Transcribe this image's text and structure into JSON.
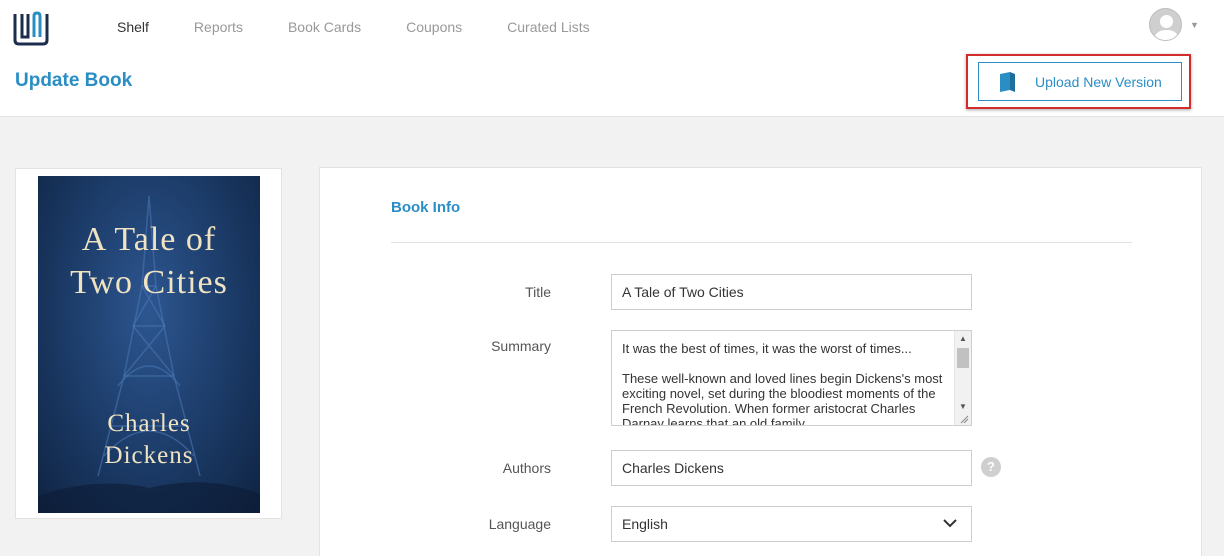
{
  "nav": {
    "items": [
      {
        "label": "Shelf",
        "active": true
      },
      {
        "label": "Reports",
        "active": false
      },
      {
        "label": "Book Cards",
        "active": false
      },
      {
        "label": "Coupons",
        "active": false
      },
      {
        "label": "Curated Lists",
        "active": false
      }
    ]
  },
  "header": {
    "page_title": "Update Book",
    "upload_button_label": "Upload New Version"
  },
  "cover": {
    "title_line1": "A Tale of",
    "title_line2": "Two Cities",
    "author_line1": "Charles",
    "author_line2": "Dickens"
  },
  "form": {
    "section_title": "Book Info",
    "title_label": "Title",
    "title_value": "A Tale of Two Cities",
    "summary_label": "Summary",
    "summary_value": "It was the best of times, it was the worst of times...\n\nThese well-known and loved lines begin Dickens's most exciting novel, set during the bloodiest moments of the French Revolution. When former aristocrat Charles Darnay learns that an old family",
    "authors_label": "Authors",
    "authors_value": "Charles Dickens",
    "help_glyph": "?",
    "language_label": "Language",
    "language_value": "English"
  },
  "colors": {
    "accent": "#2a8ec5",
    "highlight": "#d22b2b",
    "inactive_nav": "#999999"
  },
  "icons": {
    "logo": "brand-logo-icon",
    "avatar": "user-avatar-icon",
    "upload": "book-icon",
    "help": "question-icon",
    "select": "chevron-down-icon"
  }
}
